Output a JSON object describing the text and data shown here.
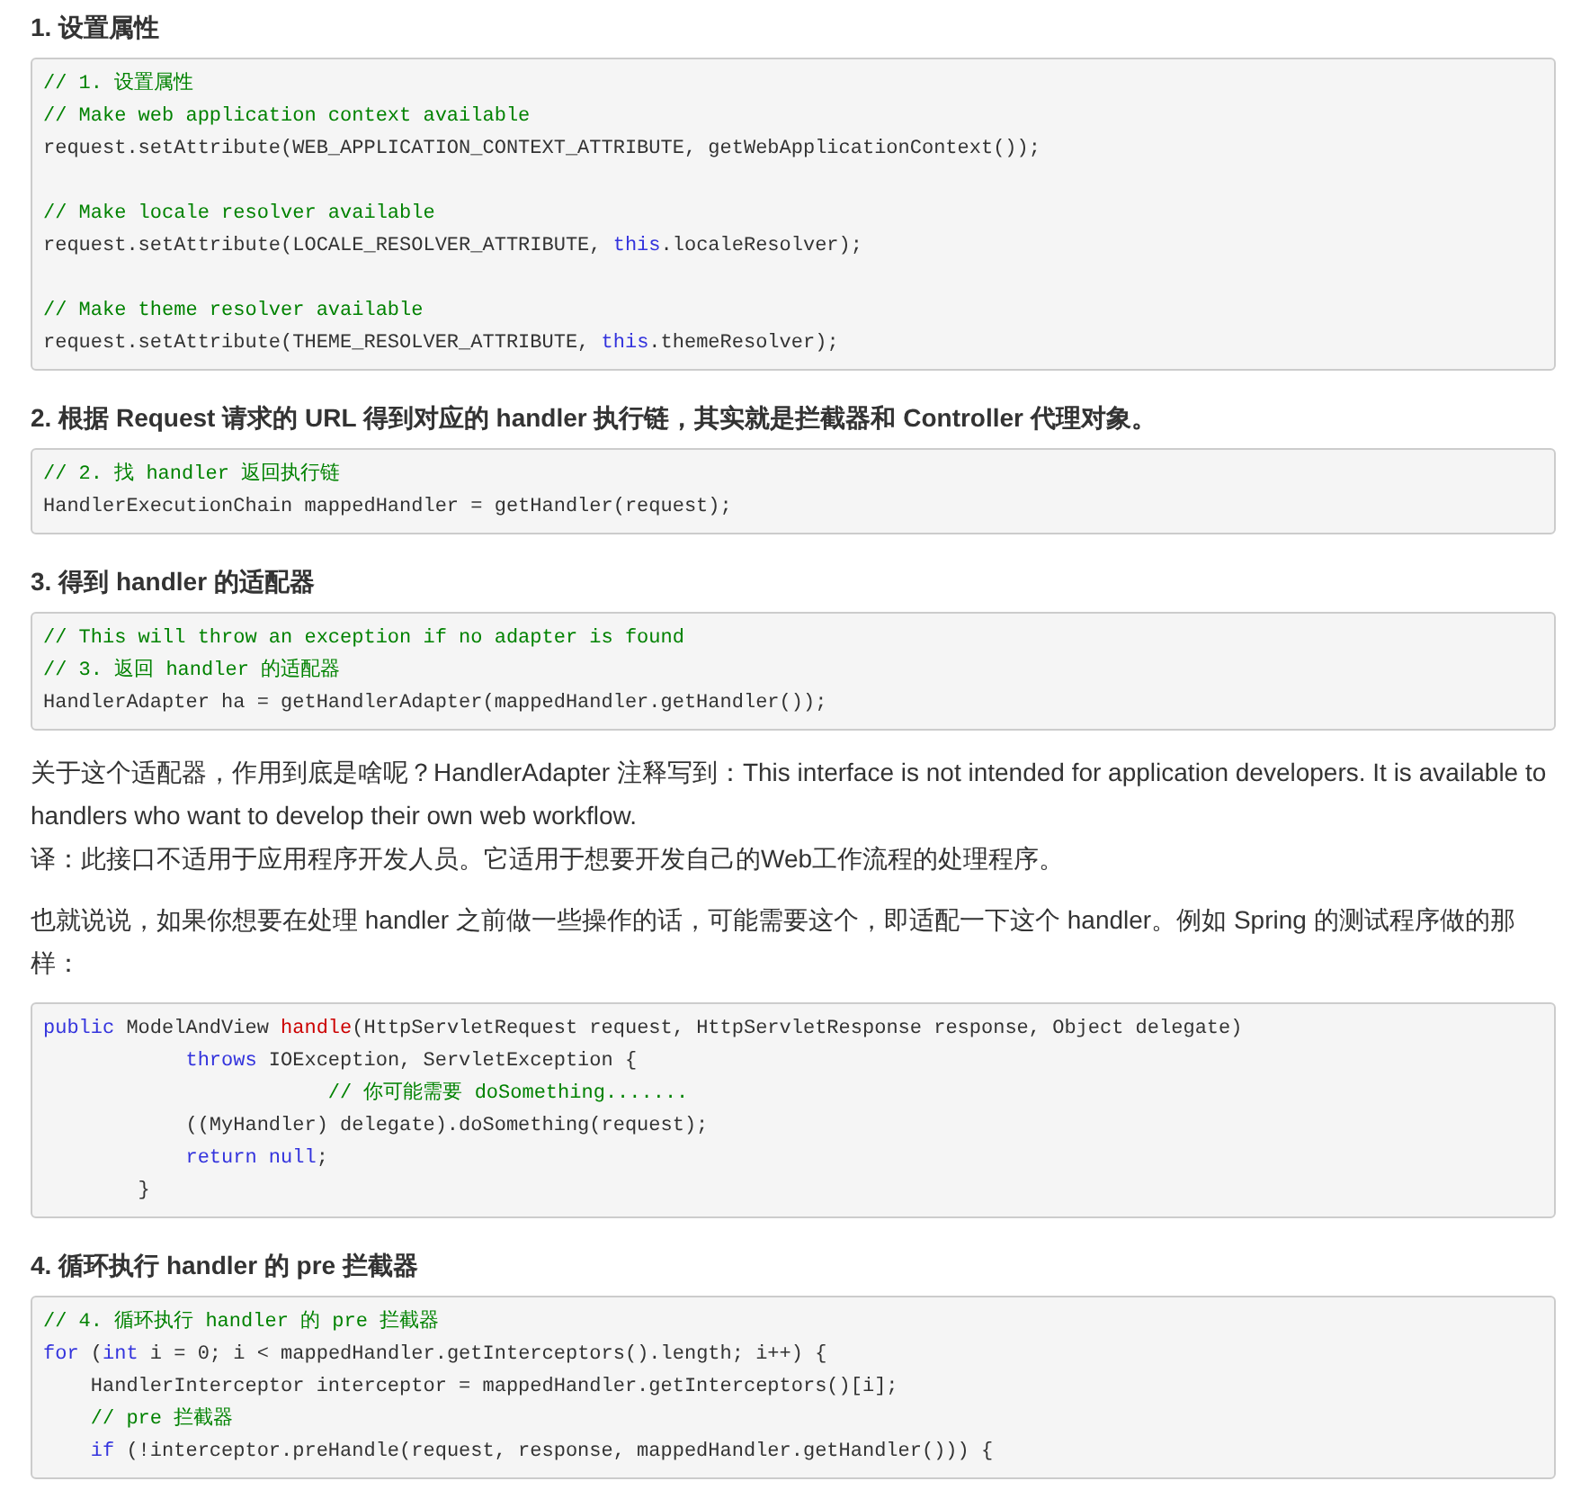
{
  "blocks": [
    {
      "kind": "heading",
      "text": "1. 设置属性"
    },
    {
      "kind": "code",
      "groups": [
        [
          [
            {
              "kind": "comment",
              "text": "// 1. 设置属性"
            }
          ],
          [
            {
              "kind": "comment",
              "text": "// Make web application context available"
            }
          ],
          [
            {
              "kind": "plain",
              "text": "request.setAttribute(WEB_APPLICATION_CONTEXT_ATTRIBUTE, getWebApplicationContext());"
            }
          ]
        ],
        [
          [
            {
              "kind": "comment",
              "text": "// Make locale resolver available"
            }
          ],
          [
            {
              "kind": "plain",
              "text": "request.setAttribute(LOCALE_RESOLVER_ATTRIBUTE, "
            },
            {
              "kind": "keyword",
              "text": "this"
            },
            {
              "kind": "plain",
              "text": ".localeResolver);"
            }
          ]
        ],
        [
          [
            {
              "kind": "comment",
              "text": "// Make theme resolver available"
            }
          ],
          [
            {
              "kind": "plain",
              "text": "request.setAttribute(THEME_RESOLVER_ATTRIBUTE, "
            },
            {
              "kind": "keyword",
              "text": "this"
            },
            {
              "kind": "plain",
              "text": ".themeResolver);"
            }
          ]
        ]
      ]
    },
    {
      "kind": "heading",
      "text": "2. 根据 Request 请求的 URL 得到对应的 handler 执行链，其实就是拦截器和 Controller 代理对象。"
    },
    {
      "kind": "code",
      "groups": [
        [
          [
            {
              "kind": "comment",
              "text": "// 2. 找 handler 返回执行链"
            }
          ],
          [
            {
              "kind": "plain",
              "text": "HandlerExecutionChain mappedHandler = getHandler(request);"
            }
          ]
        ]
      ]
    },
    {
      "kind": "heading",
      "text": "3. 得到 handler 的适配器"
    },
    {
      "kind": "code",
      "groups": [
        [
          [
            {
              "kind": "comment",
              "text": "// This will throw an exception if no adapter is found"
            }
          ],
          [
            {
              "kind": "comment",
              "text": "// 3. 返回 handler 的适配器"
            }
          ],
          [
            {
              "kind": "plain",
              "text": "HandlerAdapter ha = getHandlerAdapter(mappedHandler.getHandler());"
            }
          ]
        ]
      ]
    },
    {
      "kind": "paragraph",
      "texts": [
        "关于这个适配器，作用到底是啥呢？HandlerAdapter 注释写到：This interface is not intended for application developers. It is available to handlers who want to develop their own web workflow.",
        "译：此接口不适用于应用程序开发人员。它适用于想要开发自己的Web工作流程的处理程序。"
      ]
    },
    {
      "kind": "paragraph",
      "texts": [
        "也就说说，如果你想要在处理 handler 之前做一些操作的话，可能需要这个，即适配一下这个 handler。例如 Spring 的测试程序做的那样："
      ]
    },
    {
      "kind": "code",
      "groups": [
        [
          [
            {
              "kind": "keyword",
              "text": "public"
            },
            {
              "kind": "plain",
              "text": " ModelAndView "
            },
            {
              "kind": "function",
              "text": "handle"
            },
            {
              "kind": "plain",
              "text": "(HttpServletRequest request, HttpServletResponse response, Object delegate)"
            }
          ],
          [
            {
              "kind": "keyword",
              "text": "            throws"
            },
            {
              "kind": "plain",
              "text": " IOException, ServletException {"
            }
          ],
          [
            {
              "kind": "comment",
              "text": "                        // 你可能需要 doSomething......."
            }
          ],
          [
            {
              "kind": "plain",
              "text": "            ((MyHandler) delegate).doSomething(request);"
            }
          ],
          [
            {
              "kind": "keyword",
              "text": "            return"
            },
            {
              "kind": "keyword",
              "text": " null"
            },
            {
              "kind": "plain",
              "text": ";"
            }
          ],
          [
            {
              "kind": "plain",
              "text": "        }"
            }
          ]
        ]
      ]
    },
    {
      "kind": "heading",
      "text": "4. 循环执行 handler 的 pre 拦截器"
    },
    {
      "kind": "code",
      "groups": [
        [
          [
            {
              "kind": "comment",
              "text": "// 4. 循环执行 handler 的 pre 拦截器"
            }
          ],
          [
            {
              "kind": "keyword",
              "text": "for"
            },
            {
              "kind": "plain",
              "text": " ("
            },
            {
              "kind": "keyword",
              "text": "int"
            },
            {
              "kind": "plain",
              "text": " i = 0; i < mappedHandler.getInterceptors().length; i++) {"
            }
          ],
          [
            {
              "kind": "plain",
              "text": "    HandlerInterceptor interceptor = mappedHandler.getInterceptors()[i];"
            }
          ],
          [
            {
              "kind": "comment",
              "text": "    // pre 拦截器"
            }
          ],
          [
            {
              "kind": "keyword",
              "text": "    if"
            },
            {
              "kind": "plain",
              "text": " (!interceptor.preHandle(request, response, mappedHandler.getHandler())) {"
            }
          ]
        ]
      ]
    }
  ]
}
